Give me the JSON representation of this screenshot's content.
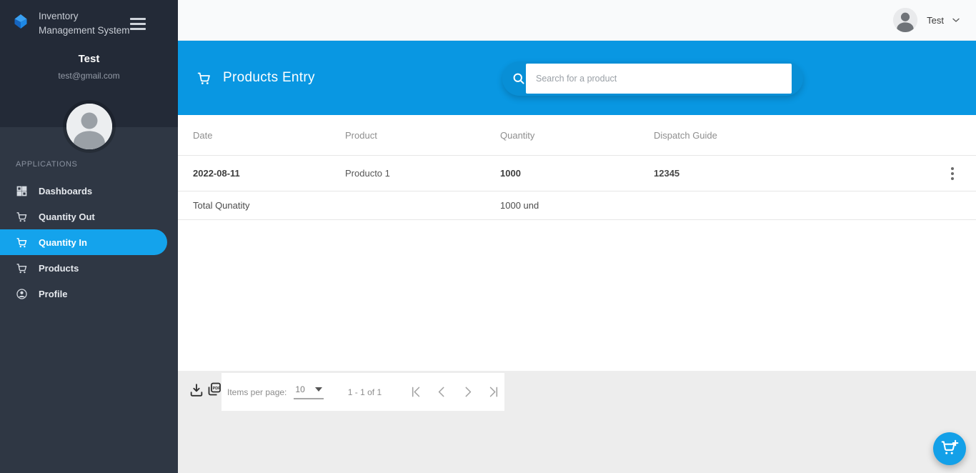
{
  "app": {
    "title": "Inventory Management System"
  },
  "sidebar": {
    "user_name": "Test",
    "user_email": "test@gmail.com",
    "section_label": "APPLICATIONS",
    "items": [
      {
        "label": "Dashboards",
        "icon": "dashboard-icon",
        "active": false
      },
      {
        "label": "Quantity Out",
        "icon": "cart-icon",
        "active": false
      },
      {
        "label": "Quantity In",
        "icon": "cart-icon",
        "active": true
      },
      {
        "label": "Products",
        "icon": "cart-icon",
        "active": false
      },
      {
        "label": "Profile",
        "icon": "person-icon",
        "active": false
      }
    ]
  },
  "topbar": {
    "user_name": "Test"
  },
  "header": {
    "title": "Products Entry",
    "search_placeholder": "Search for a product"
  },
  "table": {
    "columns": {
      "date": "Date",
      "product": "Product",
      "quantity": "Quantity",
      "dispatch_guide": "Dispatch Guide"
    },
    "rows": [
      {
        "date": "2022-08-11",
        "product": "Producto 1",
        "quantity": "1000",
        "dispatch_guide": "12345"
      }
    ],
    "total_label": "Total Qunatity",
    "total_value": "1000 und"
  },
  "paginator": {
    "items_per_page_label": "Items per page:",
    "items_per_page_value": "10",
    "range": "1 - 1 of 1"
  },
  "colors": {
    "header_blue": "#0997e2",
    "active_item_blue": "#14a3ec",
    "fab_blue": "#13a0e8",
    "sidebar_bg": "#2f3744",
    "sidebar_top_bg": "#232a37",
    "content_gray": "#ededed"
  }
}
